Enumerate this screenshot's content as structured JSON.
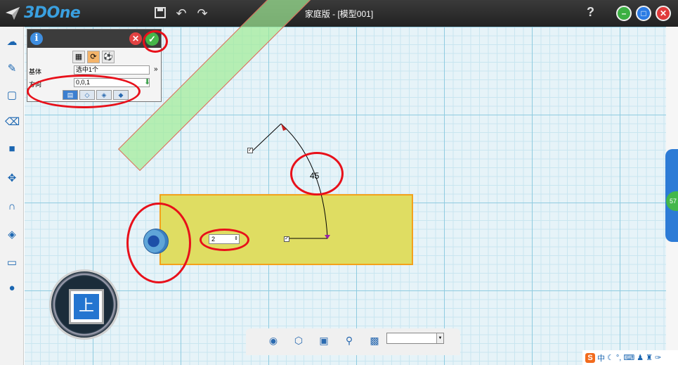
{
  "titlebar": {
    "app_name": "3DOne",
    "window_title": "家庭版 - [模型001]",
    "help_label": "?",
    "icons": [
      "save-icon",
      "undo-icon",
      "redo-icon"
    ]
  },
  "left_toolbar": {
    "tools": [
      "sketch-shapes-icon",
      "sketch-pen-icon",
      "sketch-rect-icon",
      "eraser-icon",
      "solid-cube-icon",
      "move-icon",
      "magnet-icon",
      "combine-icon",
      "layer-icon",
      "sphere-icon"
    ]
  },
  "property_panel": {
    "info_label": "i",
    "cancel_label": "✕",
    "ok_label": "✓",
    "base_label": "基体",
    "base_value": "选中1个",
    "direction_label": "方向",
    "direction_value": "0,0,1"
  },
  "canvas": {
    "angle_value": "45",
    "step_value": "2",
    "right_badge": "57"
  },
  "view_cube": {
    "face_label": "上"
  },
  "bottom_toolbar": {
    "icons": [
      "eye-icon",
      "cube-view-icon",
      "render-icon",
      "zoom-icon",
      "display-icon"
    ]
  },
  "ime": {
    "logo": "S",
    "mode": "中"
  }
}
